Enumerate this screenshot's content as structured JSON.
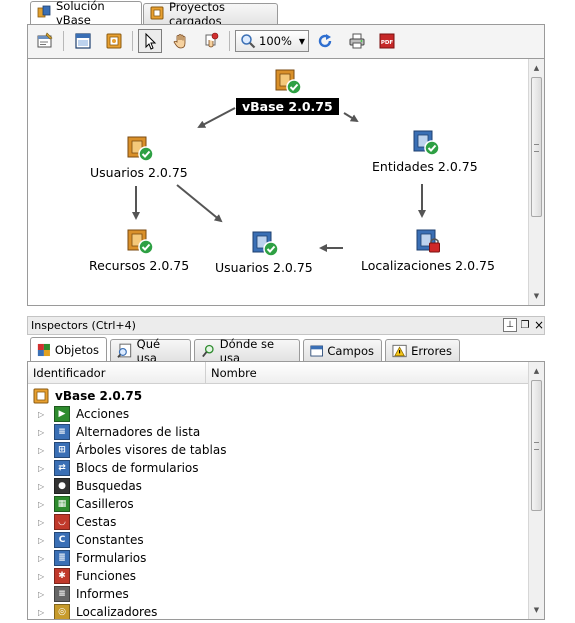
{
  "top_tabs": [
    {
      "label": "Solución vBase",
      "active": true,
      "icon": "solution-icon"
    },
    {
      "label": "Proyectos cargados",
      "active": false,
      "icon": "projects-icon"
    }
  ],
  "toolbar": {
    "zoom_value": "100%",
    "buttons": [
      "properties-icon",
      "window-icon",
      "project-icon",
      "pointer-icon",
      "hand-icon",
      "pin-icon",
      "zoom-icon",
      "refresh-icon",
      "print-icon",
      "pdf-icon"
    ]
  },
  "diagram": {
    "nodes": {
      "root": "vBase 2.0.75",
      "usuarios_left": "Usuarios 2.0.75",
      "entidades": "Entidades 2.0.75",
      "recursos": "Recursos 2.0.75",
      "usuarios_mid": "Usuarios 2.0.75",
      "localizaciones": "Localizaciones 2.0.75"
    }
  },
  "inspectors": {
    "title": "Inspectors (Ctrl+4)",
    "tabs": [
      {
        "label": "Objetos",
        "active": true,
        "icon": "objects-icon"
      },
      {
        "label": "Qué usa",
        "active": false,
        "icon": "uses-icon"
      },
      {
        "label": "Dónde se usa",
        "active": false,
        "icon": "used-where-icon"
      },
      {
        "label": "Campos",
        "active": false,
        "icon": "fields-icon"
      },
      {
        "label": "Errores",
        "active": false,
        "icon": "errors-icon"
      }
    ],
    "columns": [
      "Identificador",
      "Nombre"
    ],
    "root_item": "vBase 2.0.75",
    "items": [
      {
        "label": "Acciones",
        "icon": "actions-icon",
        "color": "#2e8b2e"
      },
      {
        "label": "Alternadores de lista",
        "icon": "list-toggle-icon",
        "color": "#3a6fb5"
      },
      {
        "label": "Árboles visores de tablas",
        "icon": "tree-viewer-icon",
        "color": "#3a6fb5"
      },
      {
        "label": "Blocs de formularios",
        "icon": "form-blocks-icon",
        "color": "#3a6fb5"
      },
      {
        "label": "Busquedas",
        "icon": "binoculars-icon",
        "color": "#333333"
      },
      {
        "label": "Casilleros",
        "icon": "lockers-icon",
        "color": "#2e8b2e"
      },
      {
        "label": "Cestas",
        "icon": "basket-icon",
        "color": "#c0392b"
      },
      {
        "label": "Constantes",
        "icon": "constant-icon",
        "color": "#3a6fb5"
      },
      {
        "label": "Formularios",
        "icon": "form-icon",
        "color": "#3a6fb5"
      },
      {
        "label": "Funciones",
        "icon": "function-gear-icon",
        "color": "#c0392b"
      },
      {
        "label": "Informes",
        "icon": "report-icon",
        "color": "#666666"
      },
      {
        "label": "Localizadores",
        "icon": "locator-icon",
        "color": "#c79b2c"
      }
    ]
  }
}
